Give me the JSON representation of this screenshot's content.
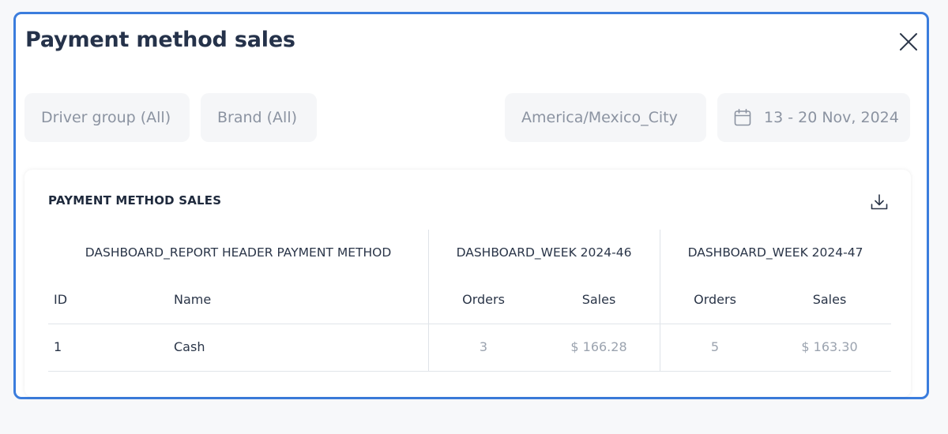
{
  "modal": {
    "title": "Payment method sales"
  },
  "filters": {
    "driver_group": "Driver group (All)",
    "brand": "Brand (All)",
    "timezone": "America/Mexico_City",
    "date_range": "13 - 20 Nov, 2024"
  },
  "card": {
    "title": "PAYMENT METHOD SALES"
  },
  "table": {
    "group_headers": [
      "DASHBOARD_REPORT HEADER PAYMENT METHOD",
      "DASHBOARD_WEEK 2024-46",
      "DASHBOARD_WEEK 2024-47"
    ],
    "columns": [
      "ID",
      "Name",
      "Orders",
      "Sales",
      "Orders",
      "Sales"
    ],
    "rows": [
      [
        "1",
        "Cash",
        "3",
        "$ 166.28",
        "5",
        "$ 163.30"
      ]
    ]
  },
  "icons": {
    "close": "close-icon",
    "calendar": "calendar-icon",
    "download": "download-icon"
  },
  "colors": {
    "accent_border": "#3b7ddd",
    "title_text": "#25324a",
    "muted_text": "#9ba3af"
  }
}
